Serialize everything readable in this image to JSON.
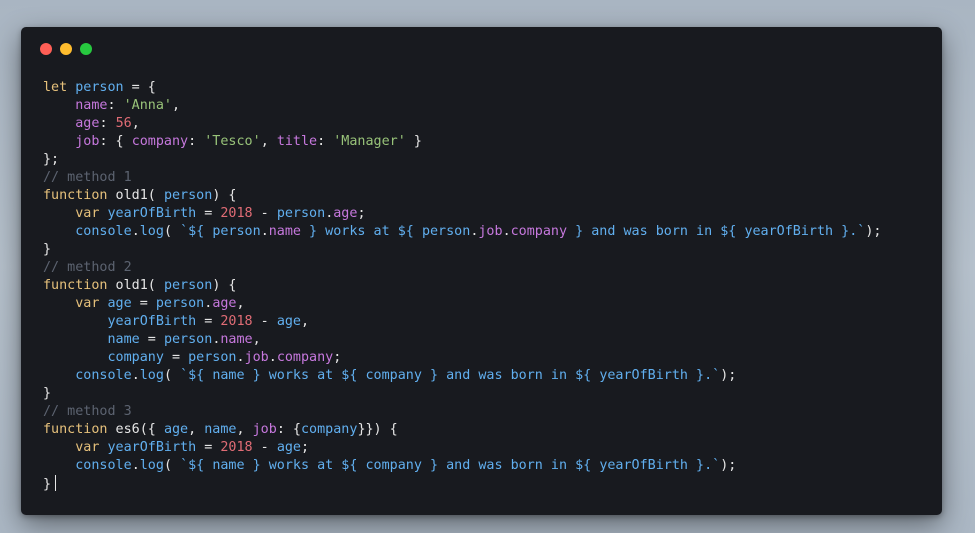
{
  "window": {
    "controls": [
      "close",
      "minimize",
      "maximize"
    ]
  },
  "code": {
    "language": "javascript",
    "lines": [
      [
        {
          "t": "let",
          "c": "kw"
        },
        {
          "t": " ",
          "c": "pun"
        },
        {
          "t": "person",
          "c": "id"
        },
        {
          "t": " = {",
          "c": "pun"
        }
      ],
      [
        {
          "t": "    ",
          "c": "pun"
        },
        {
          "t": "name",
          "c": "prop"
        },
        {
          "t": ": ",
          "c": "pun"
        },
        {
          "t": "'Anna'",
          "c": "str"
        },
        {
          "t": ",",
          "c": "pun"
        }
      ],
      [
        {
          "t": "    ",
          "c": "pun"
        },
        {
          "t": "age",
          "c": "prop"
        },
        {
          "t": ": ",
          "c": "pun"
        },
        {
          "t": "56",
          "c": "num"
        },
        {
          "t": ",",
          "c": "pun"
        }
      ],
      [
        {
          "t": "    ",
          "c": "pun"
        },
        {
          "t": "job",
          "c": "prop"
        },
        {
          "t": ": { ",
          "c": "pun"
        },
        {
          "t": "company",
          "c": "prop"
        },
        {
          "t": ": ",
          "c": "pun"
        },
        {
          "t": "'Tesco'",
          "c": "str"
        },
        {
          "t": ", ",
          "c": "pun"
        },
        {
          "t": "title",
          "c": "prop"
        },
        {
          "t": ": ",
          "c": "pun"
        },
        {
          "t": "'Manager'",
          "c": "str"
        },
        {
          "t": " }",
          "c": "pun"
        }
      ],
      [
        {
          "t": "};",
          "c": "pun"
        }
      ],
      [
        {
          "t": "// method 1",
          "c": "cmt"
        }
      ],
      [
        {
          "t": "function",
          "c": "kw"
        },
        {
          "t": " old1( ",
          "c": "fn"
        },
        {
          "t": "person",
          "c": "id"
        },
        {
          "t": ") {",
          "c": "pun"
        }
      ],
      [
        {
          "t": "    ",
          "c": "pun"
        },
        {
          "t": "var",
          "c": "kw"
        },
        {
          "t": " ",
          "c": "pun"
        },
        {
          "t": "yearOfBirth",
          "c": "id"
        },
        {
          "t": " = ",
          "c": "pun"
        },
        {
          "t": "2018",
          "c": "num"
        },
        {
          "t": " - ",
          "c": "pun"
        },
        {
          "t": "person",
          "c": "id"
        },
        {
          "t": ".",
          "c": "pun"
        },
        {
          "t": "age",
          "c": "prop"
        },
        {
          "t": ";",
          "c": "pun"
        }
      ],
      [
        {
          "t": "    ",
          "c": "pun"
        },
        {
          "t": "console",
          "c": "id"
        },
        {
          "t": ".",
          "c": "pun"
        },
        {
          "t": "log",
          "c": "id"
        },
        {
          "t": "( ",
          "c": "pun"
        },
        {
          "t": "`${ ",
          "c": "id"
        },
        {
          "t": "person",
          "c": "id"
        },
        {
          "t": ".",
          "c": "pun"
        },
        {
          "t": "name",
          "c": "prop"
        },
        {
          "t": " } works at ${ ",
          "c": "id"
        },
        {
          "t": "person",
          "c": "id"
        },
        {
          "t": ".",
          "c": "pun"
        },
        {
          "t": "job",
          "c": "prop"
        },
        {
          "t": ".",
          "c": "pun"
        },
        {
          "t": "company",
          "c": "prop"
        },
        {
          "t": " } and was born in ${ ",
          "c": "id"
        },
        {
          "t": "yearOfBirth",
          "c": "id"
        },
        {
          "t": " }.`",
          "c": "id"
        },
        {
          "t": ");",
          "c": "pun"
        }
      ],
      [
        {
          "t": "}",
          "c": "pun"
        }
      ],
      [
        {
          "t": "// method 2",
          "c": "cmt"
        }
      ],
      [
        {
          "t": "function",
          "c": "kw"
        },
        {
          "t": " old1( ",
          "c": "fn"
        },
        {
          "t": "person",
          "c": "id"
        },
        {
          "t": ") {",
          "c": "pun"
        }
      ],
      [
        {
          "t": "    ",
          "c": "pun"
        },
        {
          "t": "var",
          "c": "kw"
        },
        {
          "t": " ",
          "c": "pun"
        },
        {
          "t": "age",
          "c": "id"
        },
        {
          "t": " = ",
          "c": "pun"
        },
        {
          "t": "person",
          "c": "id"
        },
        {
          "t": ".",
          "c": "pun"
        },
        {
          "t": "age",
          "c": "prop"
        },
        {
          "t": ",",
          "c": "pun"
        }
      ],
      [
        {
          "t": "        ",
          "c": "pun"
        },
        {
          "t": "yearOfBirth",
          "c": "id"
        },
        {
          "t": " = ",
          "c": "pun"
        },
        {
          "t": "2018",
          "c": "num"
        },
        {
          "t": " - ",
          "c": "pun"
        },
        {
          "t": "age",
          "c": "id"
        },
        {
          "t": ",",
          "c": "pun"
        }
      ],
      [
        {
          "t": "        ",
          "c": "pun"
        },
        {
          "t": "name",
          "c": "id"
        },
        {
          "t": " = ",
          "c": "pun"
        },
        {
          "t": "person",
          "c": "id"
        },
        {
          "t": ".",
          "c": "pun"
        },
        {
          "t": "name",
          "c": "prop"
        },
        {
          "t": ",",
          "c": "pun"
        }
      ],
      [
        {
          "t": "        ",
          "c": "pun"
        },
        {
          "t": "company",
          "c": "id"
        },
        {
          "t": " = ",
          "c": "pun"
        },
        {
          "t": "person",
          "c": "id"
        },
        {
          "t": ".",
          "c": "pun"
        },
        {
          "t": "job",
          "c": "prop"
        },
        {
          "t": ".",
          "c": "pun"
        },
        {
          "t": "company",
          "c": "prop"
        },
        {
          "t": ";",
          "c": "pun"
        }
      ],
      [
        {
          "t": "    ",
          "c": "pun"
        },
        {
          "t": "console",
          "c": "id"
        },
        {
          "t": ".",
          "c": "pun"
        },
        {
          "t": "log",
          "c": "id"
        },
        {
          "t": "( ",
          "c": "pun"
        },
        {
          "t": "`${ ",
          "c": "id"
        },
        {
          "t": "name",
          "c": "id"
        },
        {
          "t": " } works at ${ ",
          "c": "id"
        },
        {
          "t": "company",
          "c": "id"
        },
        {
          "t": " } and was born in ${ ",
          "c": "id"
        },
        {
          "t": "yearOfBirth",
          "c": "id"
        },
        {
          "t": " }.`",
          "c": "id"
        },
        {
          "t": ");",
          "c": "pun"
        }
      ],
      [
        {
          "t": "}",
          "c": "pun"
        }
      ],
      [
        {
          "t": "// method 3",
          "c": "cmt"
        }
      ],
      [
        {
          "t": "function",
          "c": "kw"
        },
        {
          "t": " es6({ ",
          "c": "fn"
        },
        {
          "t": "age",
          "c": "id"
        },
        {
          "t": ", ",
          "c": "pun"
        },
        {
          "t": "name",
          "c": "id"
        },
        {
          "t": ", ",
          "c": "pun"
        },
        {
          "t": "job",
          "c": "prop"
        },
        {
          "t": ": {",
          "c": "pun"
        },
        {
          "t": "company",
          "c": "id"
        },
        {
          "t": "}}) {",
          "c": "pun"
        }
      ],
      [
        {
          "t": "    ",
          "c": "pun"
        },
        {
          "t": "var",
          "c": "kw"
        },
        {
          "t": " ",
          "c": "pun"
        },
        {
          "t": "yearOfBirth",
          "c": "id"
        },
        {
          "t": " = ",
          "c": "pun"
        },
        {
          "t": "2018",
          "c": "num"
        },
        {
          "t": " - ",
          "c": "pun"
        },
        {
          "t": "age",
          "c": "id"
        },
        {
          "t": ";",
          "c": "pun"
        }
      ],
      [
        {
          "t": "    ",
          "c": "pun"
        },
        {
          "t": "console",
          "c": "id"
        },
        {
          "t": ".",
          "c": "pun"
        },
        {
          "t": "log",
          "c": "id"
        },
        {
          "t": "( ",
          "c": "pun"
        },
        {
          "t": "`${ ",
          "c": "id"
        },
        {
          "t": "name",
          "c": "id"
        },
        {
          "t": " } works at ${ ",
          "c": "id"
        },
        {
          "t": "company",
          "c": "id"
        },
        {
          "t": " } and was born in ${ ",
          "c": "id"
        },
        {
          "t": "yearOfBirth",
          "c": "id"
        },
        {
          "t": " }.`",
          "c": "id"
        },
        {
          "t": ");",
          "c": "pun"
        }
      ],
      [
        {
          "t": "}",
          "c": "pun"
        }
      ]
    ]
  },
  "colors": {
    "background": "#181a1f",
    "keyword": "#e5c07b",
    "identifier": "#61afef",
    "property": "#c678dd",
    "string": "#98c379",
    "number": "#e06c75",
    "comment": "#5c6370"
  }
}
